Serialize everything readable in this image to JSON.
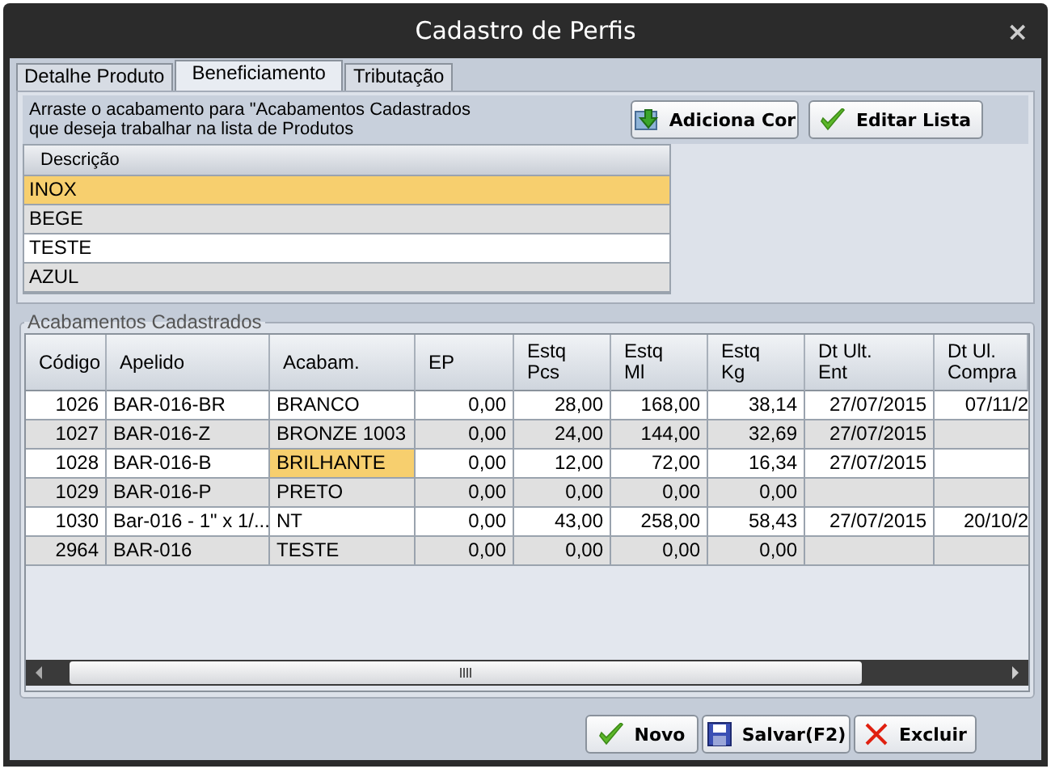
{
  "window": {
    "title": "Cadastro de Perfis",
    "close": "×"
  },
  "tabs": [
    {
      "label": "Detalhe Produto",
      "selected": false
    },
    {
      "label": "Beneficiamento",
      "selected": true
    },
    {
      "label": "Tributação",
      "selected": false
    }
  ],
  "instructions": [
    "Arraste o acabamento para \"Acabamentos Cadastrados",
    "que deseja trabalhar na lista de Produtos"
  ],
  "top_buttons": [
    {
      "label": "Adiciona Cor",
      "kind": "add"
    },
    {
      "label": "Editar Lista",
      "kind": "check"
    }
  ],
  "descricao_list": {
    "column": "Descrição",
    "items": [
      {
        "label": "INOX",
        "selected": true
      },
      {
        "label": "BEGE",
        "selected": false
      },
      {
        "label": "TESTE",
        "selected": false
      },
      {
        "label": "AZUL",
        "selected": false
      }
    ]
  },
  "group_title": "Acabamentos Cadastrados",
  "table": {
    "columns": [
      "Código",
      "Apelido",
      "Acabam.",
      "EP",
      "Estq Pcs",
      "Estq Ml",
      "Estq Kg",
      "Dt Ult. Ent",
      "Dt Ul. Compra"
    ],
    "rows": [
      {
        "cells": [
          "1026",
          "BAR-016-BR",
          "BRANCO",
          "0,00",
          "28,00",
          "168,00",
          "38,14",
          "27/07/2015",
          "07/11/2"
        ],
        "selected": false
      },
      {
        "cells": [
          "1027",
          "BAR-016-Z",
          "BRONZE 1003",
          "0,00",
          "24,00",
          "144,00",
          "32,69",
          "27/07/2015",
          ""
        ],
        "selected": false
      },
      {
        "cells": [
          "1028",
          "BAR-016-B",
          "BRILHANTE",
          "0,00",
          "12,00",
          "72,00",
          "16,34",
          "27/07/2015",
          ""
        ],
        "selected": true
      },
      {
        "cells": [
          "1029",
          "BAR-016-P",
          "PRETO",
          "0,00",
          "0,00",
          "0,00",
          "0,00",
          "",
          ""
        ],
        "selected": false
      },
      {
        "cells": [
          "1030",
          "Bar-016 - 1\" x 1/...",
          "NT",
          "0,00",
          "43,00",
          "258,00",
          "58,43",
          "27/07/2015",
          "20/10/2"
        ],
        "selected": false
      },
      {
        "cells": [
          "2964",
          "BAR-016",
          "TESTE",
          "0,00",
          "0,00",
          "0,00",
          "0,00",
          "",
          ""
        ],
        "selected": false
      }
    ]
  },
  "bottom_buttons": [
    {
      "label": "Novo",
      "kind": "check"
    },
    {
      "label": "Salvar(F2)",
      "kind": "save"
    },
    {
      "label": "Excluir",
      "kind": "delete"
    }
  ]
}
